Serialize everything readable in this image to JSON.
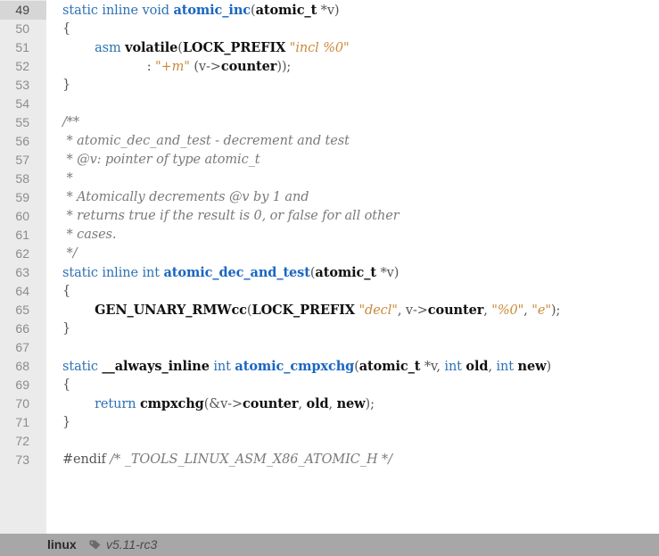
{
  "footer": {
    "repo": "linux",
    "tag": "v5.11-rc3"
  },
  "highlighted_line": "49",
  "lines": [
    {
      "num": "49",
      "tokens": [
        {
          "t": "static inline void ",
          "c": "kw"
        },
        {
          "t": "atomic_inc",
          "c": "fn"
        },
        {
          "t": "(",
          "c": "op"
        },
        {
          "t": "atomic_t",
          "c": "id"
        },
        {
          "t": " *v)",
          "c": "op"
        }
      ]
    },
    {
      "num": "50",
      "tokens": [
        {
          "t": "{",
          "c": "op"
        }
      ]
    },
    {
      "num": "51",
      "tokens": [
        {
          "t": "        ",
          "c": "pl"
        },
        {
          "t": "asm ",
          "c": "kw"
        },
        {
          "t": "volatile",
          "c": "id"
        },
        {
          "t": "(",
          "c": "op"
        },
        {
          "t": "LOCK_PREFIX",
          "c": "id"
        },
        {
          "t": " ",
          "c": "pl"
        },
        {
          "t": "\"incl %0\"",
          "c": "str"
        }
      ]
    },
    {
      "num": "52",
      "tokens": [
        {
          "t": "                     : ",
          "c": "op"
        },
        {
          "t": "\"+m\"",
          "c": "str"
        },
        {
          "t": " (v->",
          "c": "op"
        },
        {
          "t": "counter",
          "c": "id"
        },
        {
          "t": "));",
          "c": "op"
        }
      ]
    },
    {
      "num": "53",
      "tokens": [
        {
          "t": "}",
          "c": "op"
        }
      ]
    },
    {
      "num": "54",
      "tokens": []
    },
    {
      "num": "55",
      "tokens": [
        {
          "t": "/**",
          "c": "cm"
        }
      ]
    },
    {
      "num": "56",
      "tokens": [
        {
          "t": " * atomic_dec_and_test - decrement and test",
          "c": "cm"
        }
      ]
    },
    {
      "num": "57",
      "tokens": [
        {
          "t": " * @v: pointer of type atomic_t",
          "c": "cm"
        }
      ]
    },
    {
      "num": "58",
      "tokens": [
        {
          "t": " *",
          "c": "cm"
        }
      ]
    },
    {
      "num": "59",
      "tokens": [
        {
          "t": " * Atomically decrements @v by 1 and",
          "c": "cm"
        }
      ]
    },
    {
      "num": "60",
      "tokens": [
        {
          "t": " * returns true if the result is 0, or false for all other",
          "c": "cm"
        }
      ]
    },
    {
      "num": "61",
      "tokens": [
        {
          "t": " * cases.",
          "c": "cm"
        }
      ]
    },
    {
      "num": "62",
      "tokens": [
        {
          "t": " */",
          "c": "cm"
        }
      ]
    },
    {
      "num": "63",
      "tokens": [
        {
          "t": "static inline int ",
          "c": "kw"
        },
        {
          "t": "atomic_dec_and_test",
          "c": "fn"
        },
        {
          "t": "(",
          "c": "op"
        },
        {
          "t": "atomic_t",
          "c": "id"
        },
        {
          "t": " *v)",
          "c": "op"
        }
      ]
    },
    {
      "num": "64",
      "tokens": [
        {
          "t": "{",
          "c": "op"
        }
      ]
    },
    {
      "num": "65",
      "tokens": [
        {
          "t": "        ",
          "c": "pl"
        },
        {
          "t": "GEN_UNARY_RMWcc",
          "c": "id"
        },
        {
          "t": "(",
          "c": "op"
        },
        {
          "t": "LOCK_PREFIX",
          "c": "id"
        },
        {
          "t": " ",
          "c": "pl"
        },
        {
          "t": "\"decl\"",
          "c": "str"
        },
        {
          "t": ", v->",
          "c": "op"
        },
        {
          "t": "counter",
          "c": "id"
        },
        {
          "t": ", ",
          "c": "op"
        },
        {
          "t": "\"%0\"",
          "c": "str"
        },
        {
          "t": ", ",
          "c": "op"
        },
        {
          "t": "\"e\"",
          "c": "str"
        },
        {
          "t": ");",
          "c": "op"
        }
      ]
    },
    {
      "num": "66",
      "tokens": [
        {
          "t": "}",
          "c": "op"
        }
      ]
    },
    {
      "num": "67",
      "tokens": []
    },
    {
      "num": "68",
      "tokens": [
        {
          "t": "static ",
          "c": "kw"
        },
        {
          "t": "__always_inline",
          "c": "id"
        },
        {
          "t": " int ",
          "c": "kw"
        },
        {
          "t": "atomic_cmpxchg",
          "c": "fn"
        },
        {
          "t": "(",
          "c": "op"
        },
        {
          "t": "atomic_t",
          "c": "id"
        },
        {
          "t": " *v, ",
          "c": "op"
        },
        {
          "t": "int ",
          "c": "kw"
        },
        {
          "t": "old",
          "c": "id"
        },
        {
          "t": ", ",
          "c": "op"
        },
        {
          "t": "int ",
          "c": "kw"
        },
        {
          "t": "new",
          "c": "id"
        },
        {
          "t": ")",
          "c": "op"
        }
      ]
    },
    {
      "num": "69",
      "tokens": [
        {
          "t": "{",
          "c": "op"
        }
      ]
    },
    {
      "num": "70",
      "tokens": [
        {
          "t": "        ",
          "c": "pl"
        },
        {
          "t": "return ",
          "c": "kw"
        },
        {
          "t": "cmpxchg",
          "c": "id"
        },
        {
          "t": "(&v->",
          "c": "op"
        },
        {
          "t": "counter",
          "c": "id"
        },
        {
          "t": ", ",
          "c": "op"
        },
        {
          "t": "old",
          "c": "id"
        },
        {
          "t": ", ",
          "c": "op"
        },
        {
          "t": "new",
          "c": "id"
        },
        {
          "t": ");",
          "c": "op"
        }
      ]
    },
    {
      "num": "71",
      "tokens": [
        {
          "t": "}",
          "c": "op"
        }
      ]
    },
    {
      "num": "72",
      "tokens": []
    },
    {
      "num": "73",
      "tokens": [
        {
          "t": "#endif ",
          "c": "pp"
        },
        {
          "t": "/* _TOOLS_LINUX_ASM_X86_ATOMIC_H */",
          "c": "cm"
        }
      ]
    }
  ],
  "colors": {
    "keyword": "#2d71b3",
    "function": "#1a66c1",
    "string": "#c98a3a",
    "comment": "#7a7a7a",
    "gutter_bg": "#ebebeb",
    "footer_bg": "#a7a7a7"
  },
  "icons": {
    "tag": "tag-icon"
  }
}
